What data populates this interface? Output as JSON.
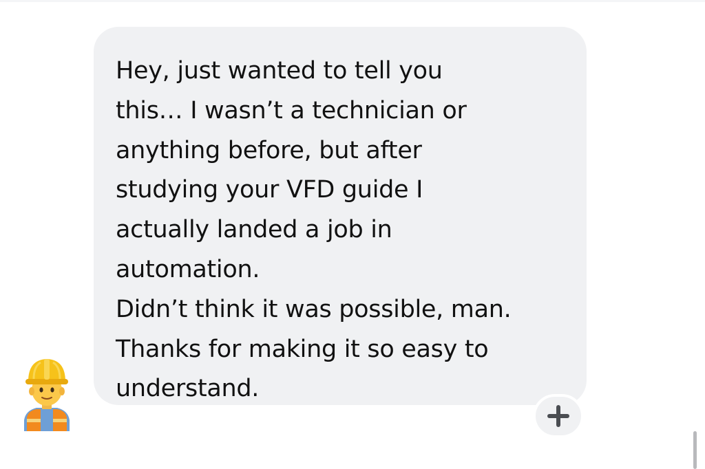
{
  "message": {
    "lines": [
      "Hey, just wanted to tell you",
      "this… I wasn’t a technician or",
      "anything before, but after",
      "studying your VFD guide I",
      "actually landed a job in",
      "automation.",
      "Didn’t think it was possible, man.",
      "Thanks for making it so easy to",
      "understand."
    ]
  },
  "avatar": {
    "icon": "construction-worker-emoji"
  },
  "reaction": {
    "icon": "plus-icon"
  },
  "colors": {
    "bubble_background": "#f0f1f3",
    "text": "#111111",
    "icon": "#4a4d52"
  }
}
